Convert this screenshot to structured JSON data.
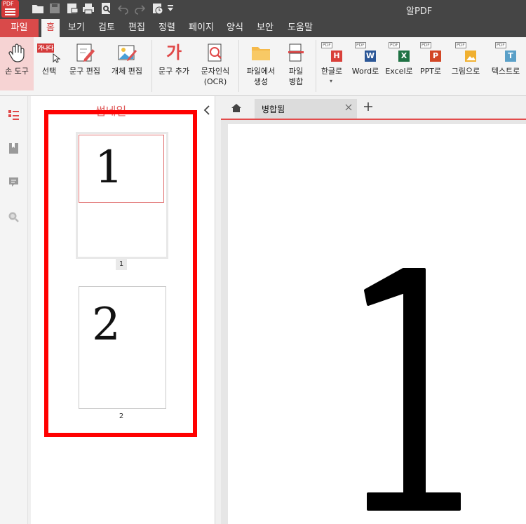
{
  "app": {
    "title": "알PDF",
    "logo_text": "PDF",
    "accent_color": "#d94a4a",
    "quick_access_icons": [
      "open-folder-icon",
      "save-icon",
      "mail-icon",
      "print-icon",
      "search-doc-icon",
      "undo-icon",
      "redo-icon",
      "history-icon",
      "dropdown-icon"
    ]
  },
  "menu": {
    "tabs": [
      {
        "label": "파일",
        "state": "file"
      },
      {
        "label": "홈",
        "state": "active"
      },
      {
        "label": "보기"
      },
      {
        "label": "검토"
      },
      {
        "label": "편집"
      },
      {
        "label": "정렬"
      },
      {
        "label": "페이지"
      },
      {
        "label": "양식"
      },
      {
        "label": "보안"
      },
      {
        "label": "도움말"
      }
    ]
  },
  "ribbon": {
    "hand_tool": "손 도구",
    "select": "선택",
    "select_badge": "가나다",
    "text_edit": "문구 편집",
    "object_edit": "개체 편집",
    "add_text": "문구 추가",
    "add_text_glyph": "가",
    "ocr": "문자인식\n(OCR)",
    "create_from_file": "파일에서\n생성",
    "merge_files": "파일\n병합",
    "to_hangul": "한글로",
    "to_word": "Word로",
    "to_excel": "Excel로",
    "to_ppt": "PPT로",
    "to_image": "그림으로",
    "to_text": "텍스트로",
    "convert_badges": {
      "hangul": "H",
      "word": "W",
      "excel": "X",
      "ppt": "P",
      "text": "T",
      "pdf": "PDF"
    }
  },
  "sidebar": {
    "icons": [
      "thumbnails-icon",
      "bookmark-icon",
      "comment-icon",
      "search-icon"
    ]
  },
  "thumbnails": {
    "title": "썸네일",
    "pages": [
      {
        "number": "1",
        "content": "1"
      },
      {
        "number": "2",
        "content": "2"
      }
    ]
  },
  "document": {
    "tab_label": "병합됨",
    "page_content": "1"
  }
}
